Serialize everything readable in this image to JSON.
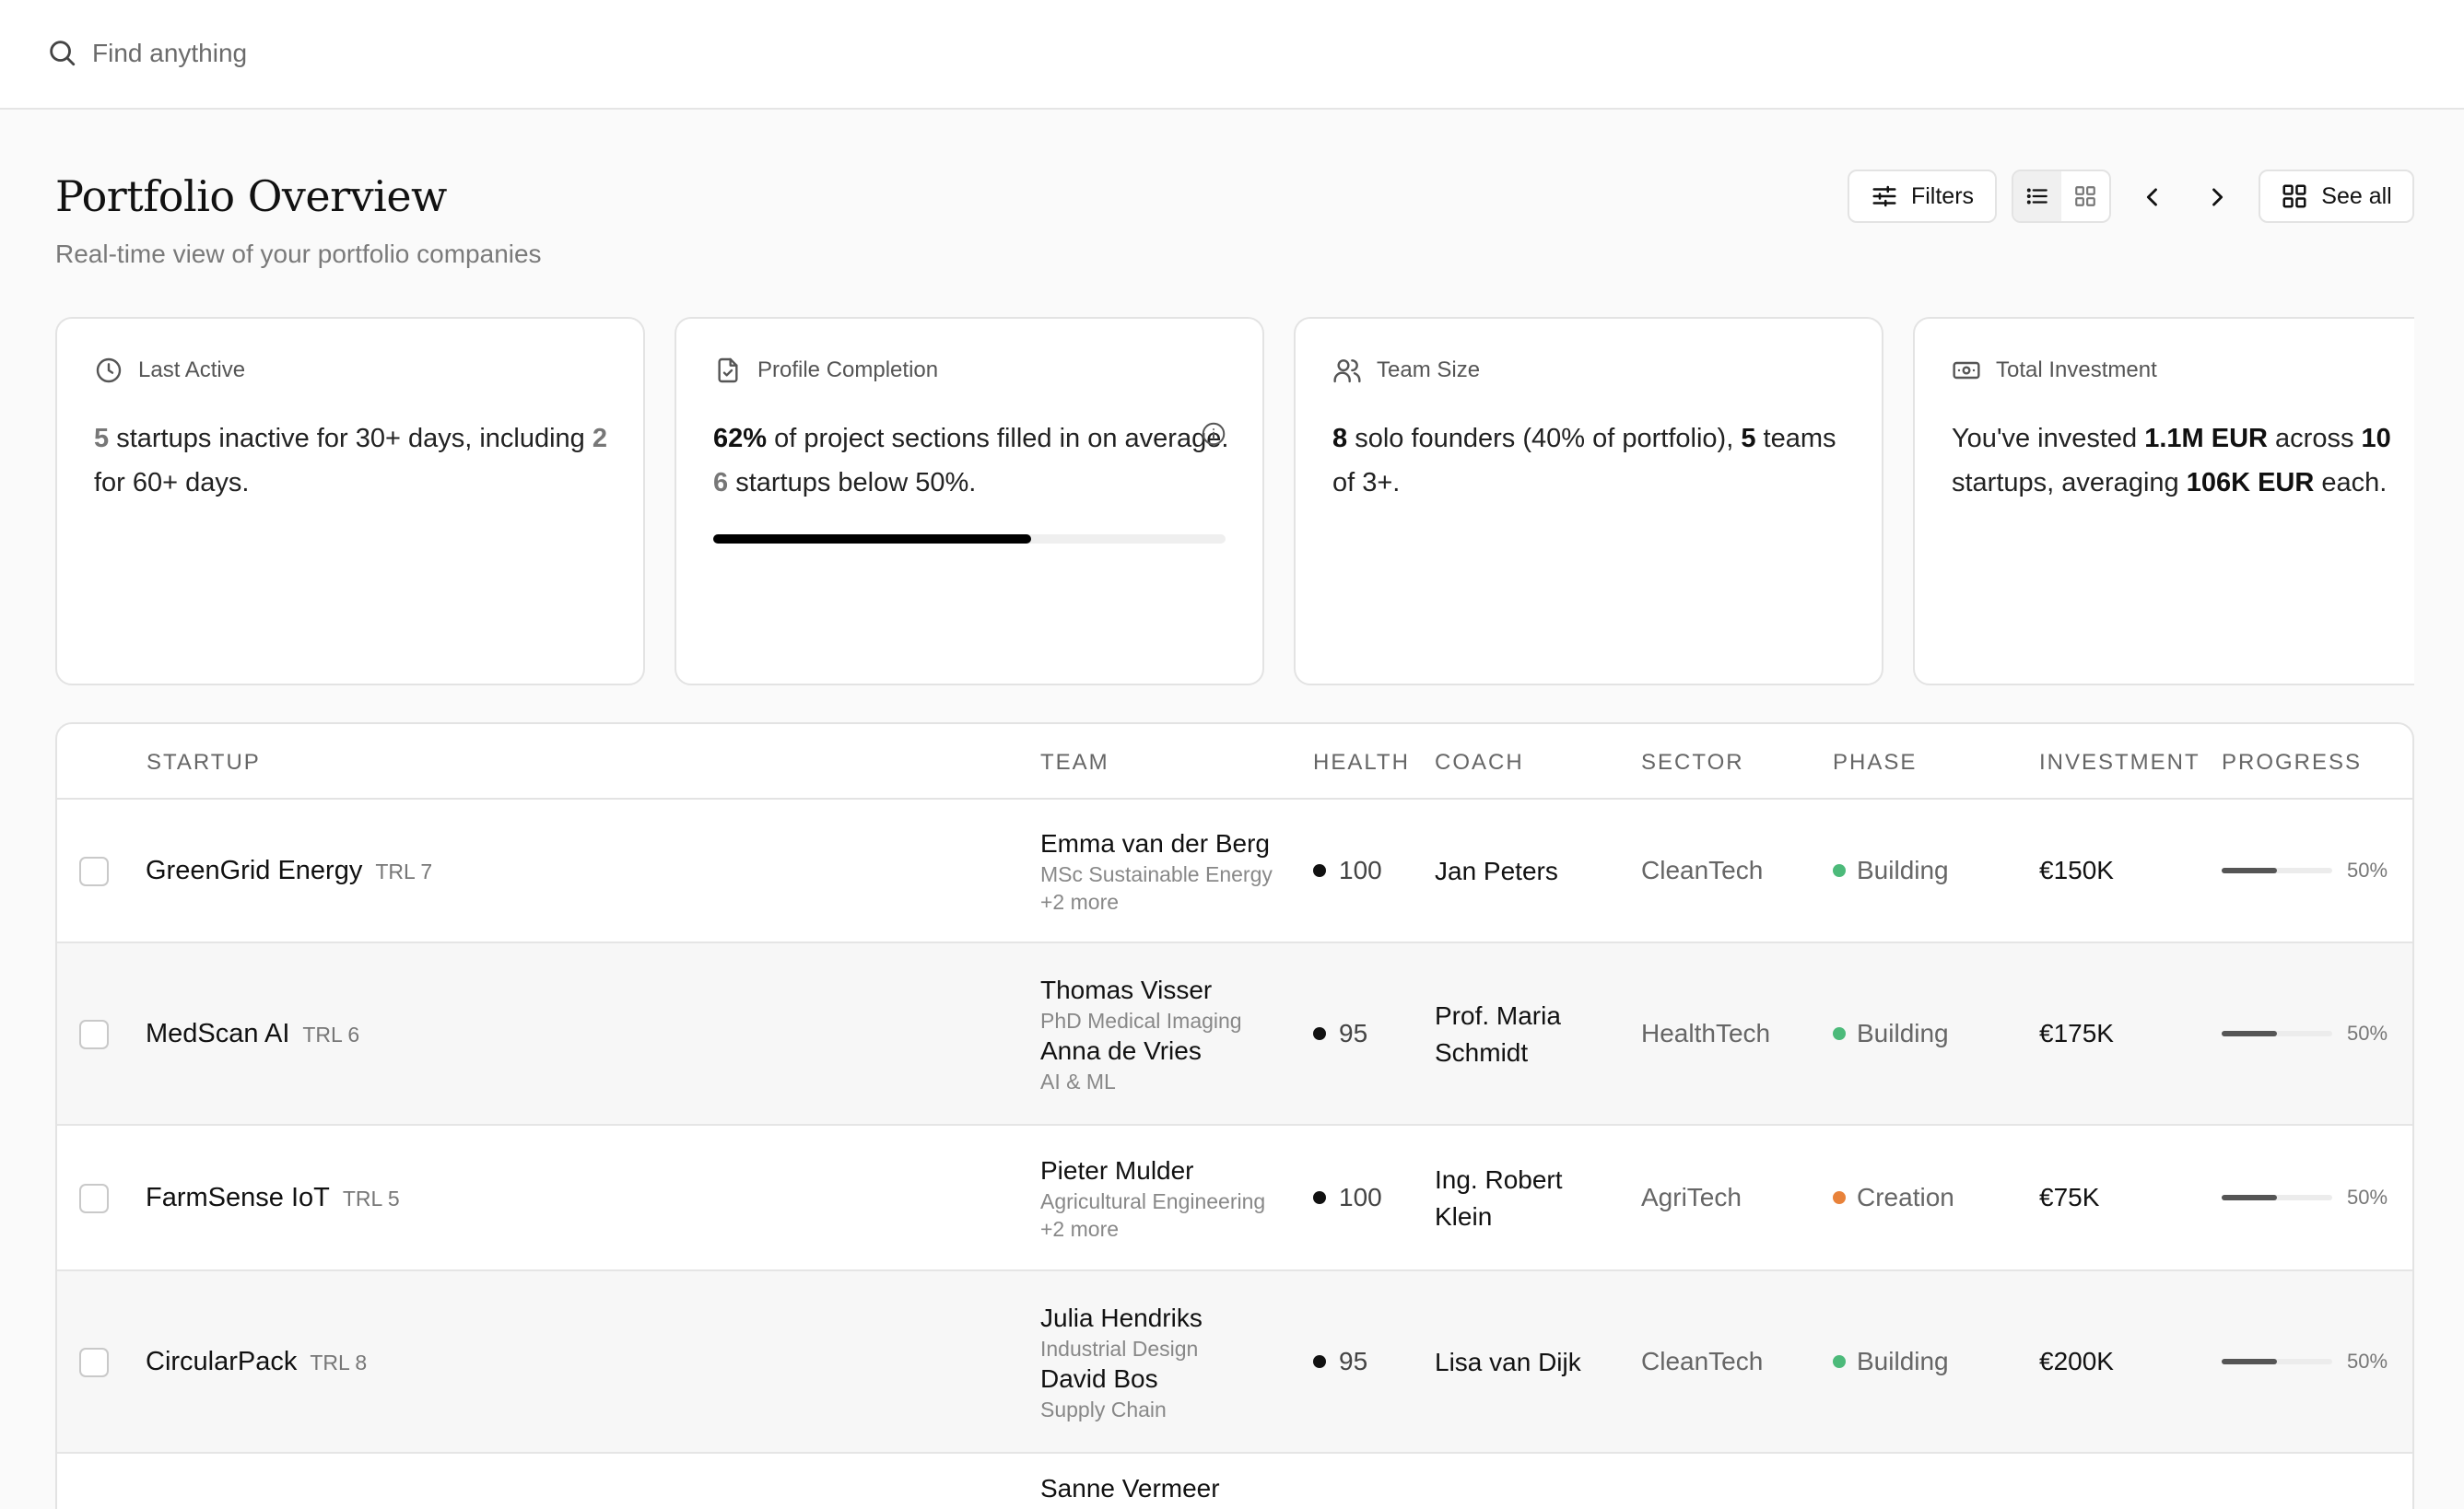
{
  "search": {
    "placeholder": "Find anything"
  },
  "header": {
    "title": "Portfolio Overview",
    "subtitle": "Real-time view of your portfolio companies"
  },
  "toolbar": {
    "filters_label": "Filters",
    "see_all_label": "See all"
  },
  "cards": [
    {
      "label": "Last Active",
      "icon": "clock-icon",
      "parts": [
        {
          "t": "5",
          "s": "mute"
        },
        {
          "t": " startups inactive for 30+ days, including "
        },
        {
          "t": "2",
          "s": "mute"
        },
        {
          "t": " for 60+ days."
        }
      ]
    },
    {
      "label": "Profile Completion",
      "icon": "file-check-icon",
      "parts": [
        {
          "t": "62%",
          "s": "b"
        },
        {
          "t": " of project sections filled in on average. "
        },
        {
          "t": "6",
          "s": "mute"
        },
        {
          "t": " startups below 50%."
        }
      ],
      "progress": 0.62
    },
    {
      "label": "Team Size",
      "icon": "users-icon",
      "parts": [
        {
          "t": "8",
          "s": "b"
        },
        {
          "t": " solo founders (40% of portfolio), "
        },
        {
          "t": "5",
          "s": "b"
        },
        {
          "t": " teams of 3+."
        }
      ]
    },
    {
      "label": "Total Investment",
      "icon": "banknote-icon",
      "parts": [
        {
          "t": "You've invested "
        },
        {
          "t": "1.1M EUR",
          "s": "b"
        },
        {
          "t": " across "
        },
        {
          "t": "10",
          "s": "b"
        },
        {
          "t": " startups, averaging "
        },
        {
          "t": "106K EUR",
          "s": "b"
        },
        {
          "t": " each."
        }
      ]
    }
  ],
  "table": {
    "columns": [
      "STARTUP",
      "TEAM",
      "HEALTH",
      "COACH",
      "SECTOR",
      "PHASE",
      "INVESTMENT",
      "PROGRESS"
    ],
    "rows": [
      {
        "name": "GreenGrid Energy",
        "trl": "TRL 7",
        "team": [
          {
            "name": "Emma van der Berg",
            "sub": "MSc Sustainable Energy"
          }
        ],
        "more": "+2 more",
        "health": "100",
        "coach": "Jan Peters",
        "sector": "CleanTech",
        "phase": "Building",
        "phase_color": "#4cba7a",
        "investment": "€150K",
        "progress": 0.5,
        "progress_label": "50%"
      },
      {
        "name": "MedScan AI",
        "trl": "TRL 6",
        "team": [
          {
            "name": "Thomas Visser",
            "sub": "PhD Medical Imaging"
          },
          {
            "name": "Anna de Vries",
            "sub": "AI & ML"
          }
        ],
        "more": "",
        "health": "95",
        "coach": "Prof. Maria Schmidt",
        "sector": "HealthTech",
        "phase": "Building",
        "phase_color": "#4cba7a",
        "investment": "€175K",
        "progress": 0.5,
        "progress_label": "50%"
      },
      {
        "name": "FarmSense IoT",
        "trl": "TRL 5",
        "team": [
          {
            "name": "Pieter Mulder",
            "sub": "Agricultural Engineering"
          }
        ],
        "more": "+2 more",
        "health": "100",
        "coach": "Ing. Robert Klein",
        "sector": "AgriTech",
        "phase": "Creation",
        "phase_color": "#e8823a",
        "investment": "€75K",
        "progress": 0.5,
        "progress_label": "50%"
      },
      {
        "name": "CircularPack",
        "trl": "TRL 8",
        "team": [
          {
            "name": "Julia Hendriks",
            "sub": "Industrial Design"
          },
          {
            "name": "David Bos",
            "sub": "Supply Chain"
          }
        ],
        "more": "",
        "health": "95",
        "coach": "Lisa van Dijk",
        "sector": "CleanTech",
        "phase": "Building",
        "phase_color": "#4cba7a",
        "investment": "€200K",
        "progress": 0.5,
        "progress_label": "50%"
      },
      {
        "name": "",
        "trl": "",
        "team": [
          {
            "name": "Sanne Vermeer",
            "sub": ""
          }
        ],
        "more": "",
        "health": "",
        "coach": "",
        "sector": "",
        "phase": "",
        "phase_color": "#4cba7a",
        "investment": "",
        "progress": null,
        "progress_label": ""
      }
    ]
  }
}
